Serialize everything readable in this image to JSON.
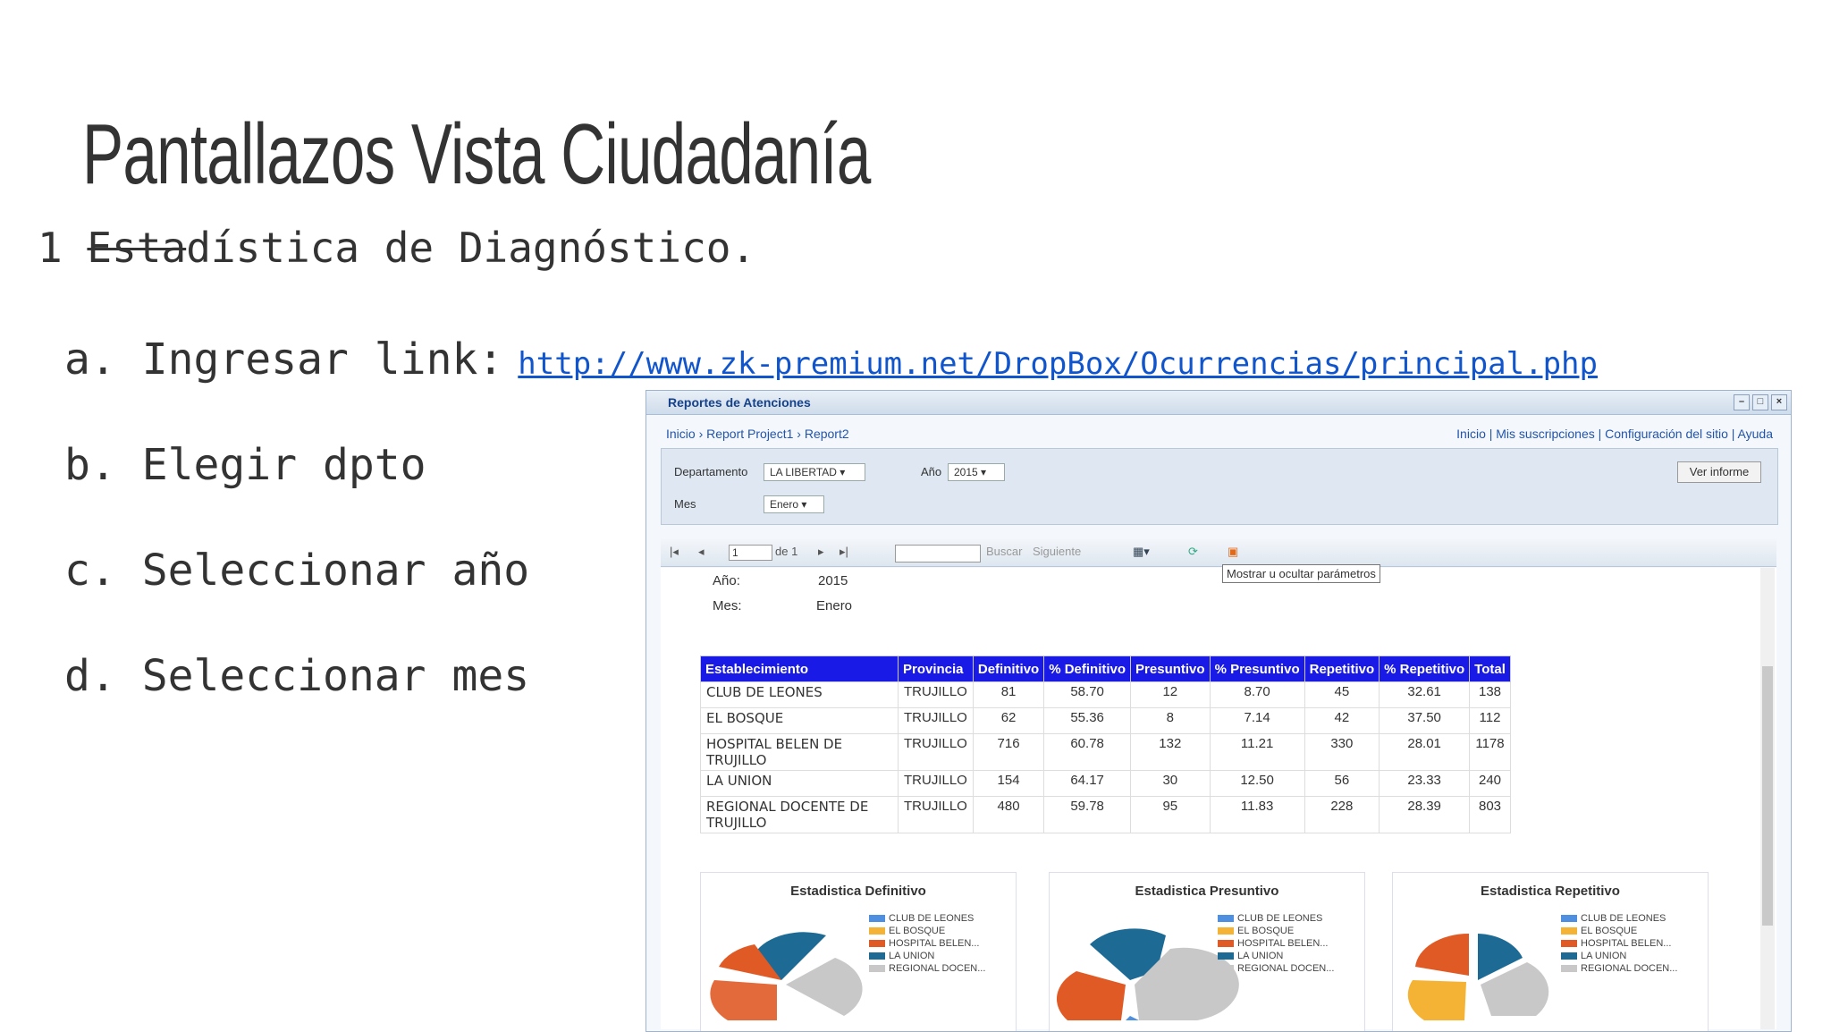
{
  "slide": {
    "title": "Pantallazos Vista Ciudadanía",
    "line1_num": "1",
    "line1_strike": "Esta",
    "line1_rest": "dística de Diagnóstico.",
    "steps": [
      {
        "label": "a. Ingresar link:",
        "link": "http://www.zk-premium.net/DropBox/Ocurrencias/principal.php"
      },
      {
        "label": "b. Elegir dpto"
      },
      {
        "label": "c. Seleccionar año"
      },
      {
        "label": "d. Seleccionar mes"
      }
    ]
  },
  "window": {
    "title": "Reportes de Atenciones",
    "breadcrumb": "Inicio › Report Project1 › Report2",
    "top_links": "Inicio | Mis suscripciones | Configuración del sitio | Ayuda",
    "params": {
      "departamento_label": "Departamento",
      "departamento_value": "LA LIBERTAD",
      "anio_label": "Año",
      "anio_value": "2015",
      "mes_label": "Mes",
      "mes_value": "Enero",
      "ver_informe": "Ver informe"
    },
    "toolbar": {
      "page": "1",
      "of": "de 1",
      "find": "Buscar",
      "next": "Siguiente",
      "tooltip": "Mostrar u ocultar parámetros"
    },
    "report": {
      "anio_label": "Año:",
      "anio_value": "2015",
      "mes_label": "Mes:",
      "mes_value": "Enero",
      "columns": [
        "Establecimiento",
        "Provincia",
        "Definitivo",
        "% Definitivo",
        "Presuntivo",
        "% Presuntivo",
        "Repetitivo",
        "% Repetitivo",
        "Total"
      ],
      "rows": [
        [
          "CLUB DE LEONES",
          "TRUJILLO",
          "81",
          "58.70",
          "12",
          "8.70",
          "45",
          "32.61",
          "138"
        ],
        [
          "EL BOSQUE",
          "TRUJILLO",
          "62",
          "55.36",
          "8",
          "7.14",
          "42",
          "37.50",
          "112"
        ],
        [
          "HOSPITAL BELEN DE TRUJILLO",
          "TRUJILLO",
          "716",
          "60.78",
          "132",
          "11.21",
          "330",
          "28.01",
          "1178"
        ],
        [
          "LA UNION",
          "TRUJILLO",
          "154",
          "64.17",
          "30",
          "12.50",
          "56",
          "23.33",
          "240"
        ],
        [
          "REGIONAL DOCENTE DE TRUJILLO",
          "TRUJILLO",
          "480",
          "59.78",
          "95",
          "11.83",
          "228",
          "28.39",
          "803"
        ]
      ],
      "legend": [
        "CLUB DE LEONES",
        "EL BOSQUE",
        "HOSPITAL BELEN...",
        "LA UNION",
        "REGIONAL DOCEN..."
      ],
      "legend_colors": [
        "#4f8fe0",
        "#f5b335",
        "#e05a26",
        "#1d6b95",
        "#c8c8c8"
      ],
      "charts": [
        {
          "title": "Estadistica Definitivo"
        },
        {
          "title": "Estadistica Presuntivo"
        },
        {
          "title": "Estadistica Repetitivo"
        }
      ]
    }
  }
}
